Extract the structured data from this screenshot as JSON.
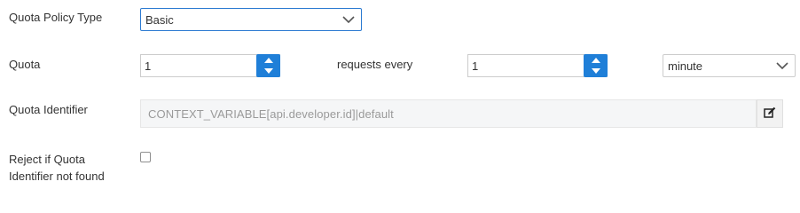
{
  "quota_policy_type": {
    "label": "Quota Policy Type",
    "selected": "Basic"
  },
  "quota": {
    "label": "Quota",
    "requests_value": "1",
    "requests_every_text": "requests every",
    "interval_value": "1",
    "unit_selected": "minute"
  },
  "quota_identifier": {
    "label": "Quota Identifier",
    "value": "CONTEXT_VARIABLE[api.developer.id]|default"
  },
  "reject_if_not_found": {
    "label_line1": "Reject if Quota",
    "label_line2": "Identifier not found",
    "checked": false
  },
  "colors": {
    "accent": "#1f7fd8",
    "focus_border": "#2b7ad1",
    "readonly_bg": "#f5f6f7",
    "text": "#333333",
    "muted_text": "#9a9a9a"
  },
  "icons": {
    "dropdown": "chevron-down-icon",
    "spinner_up": "caret-up-icon",
    "spinner_down": "caret-down-icon",
    "edit": "edit-icon"
  }
}
